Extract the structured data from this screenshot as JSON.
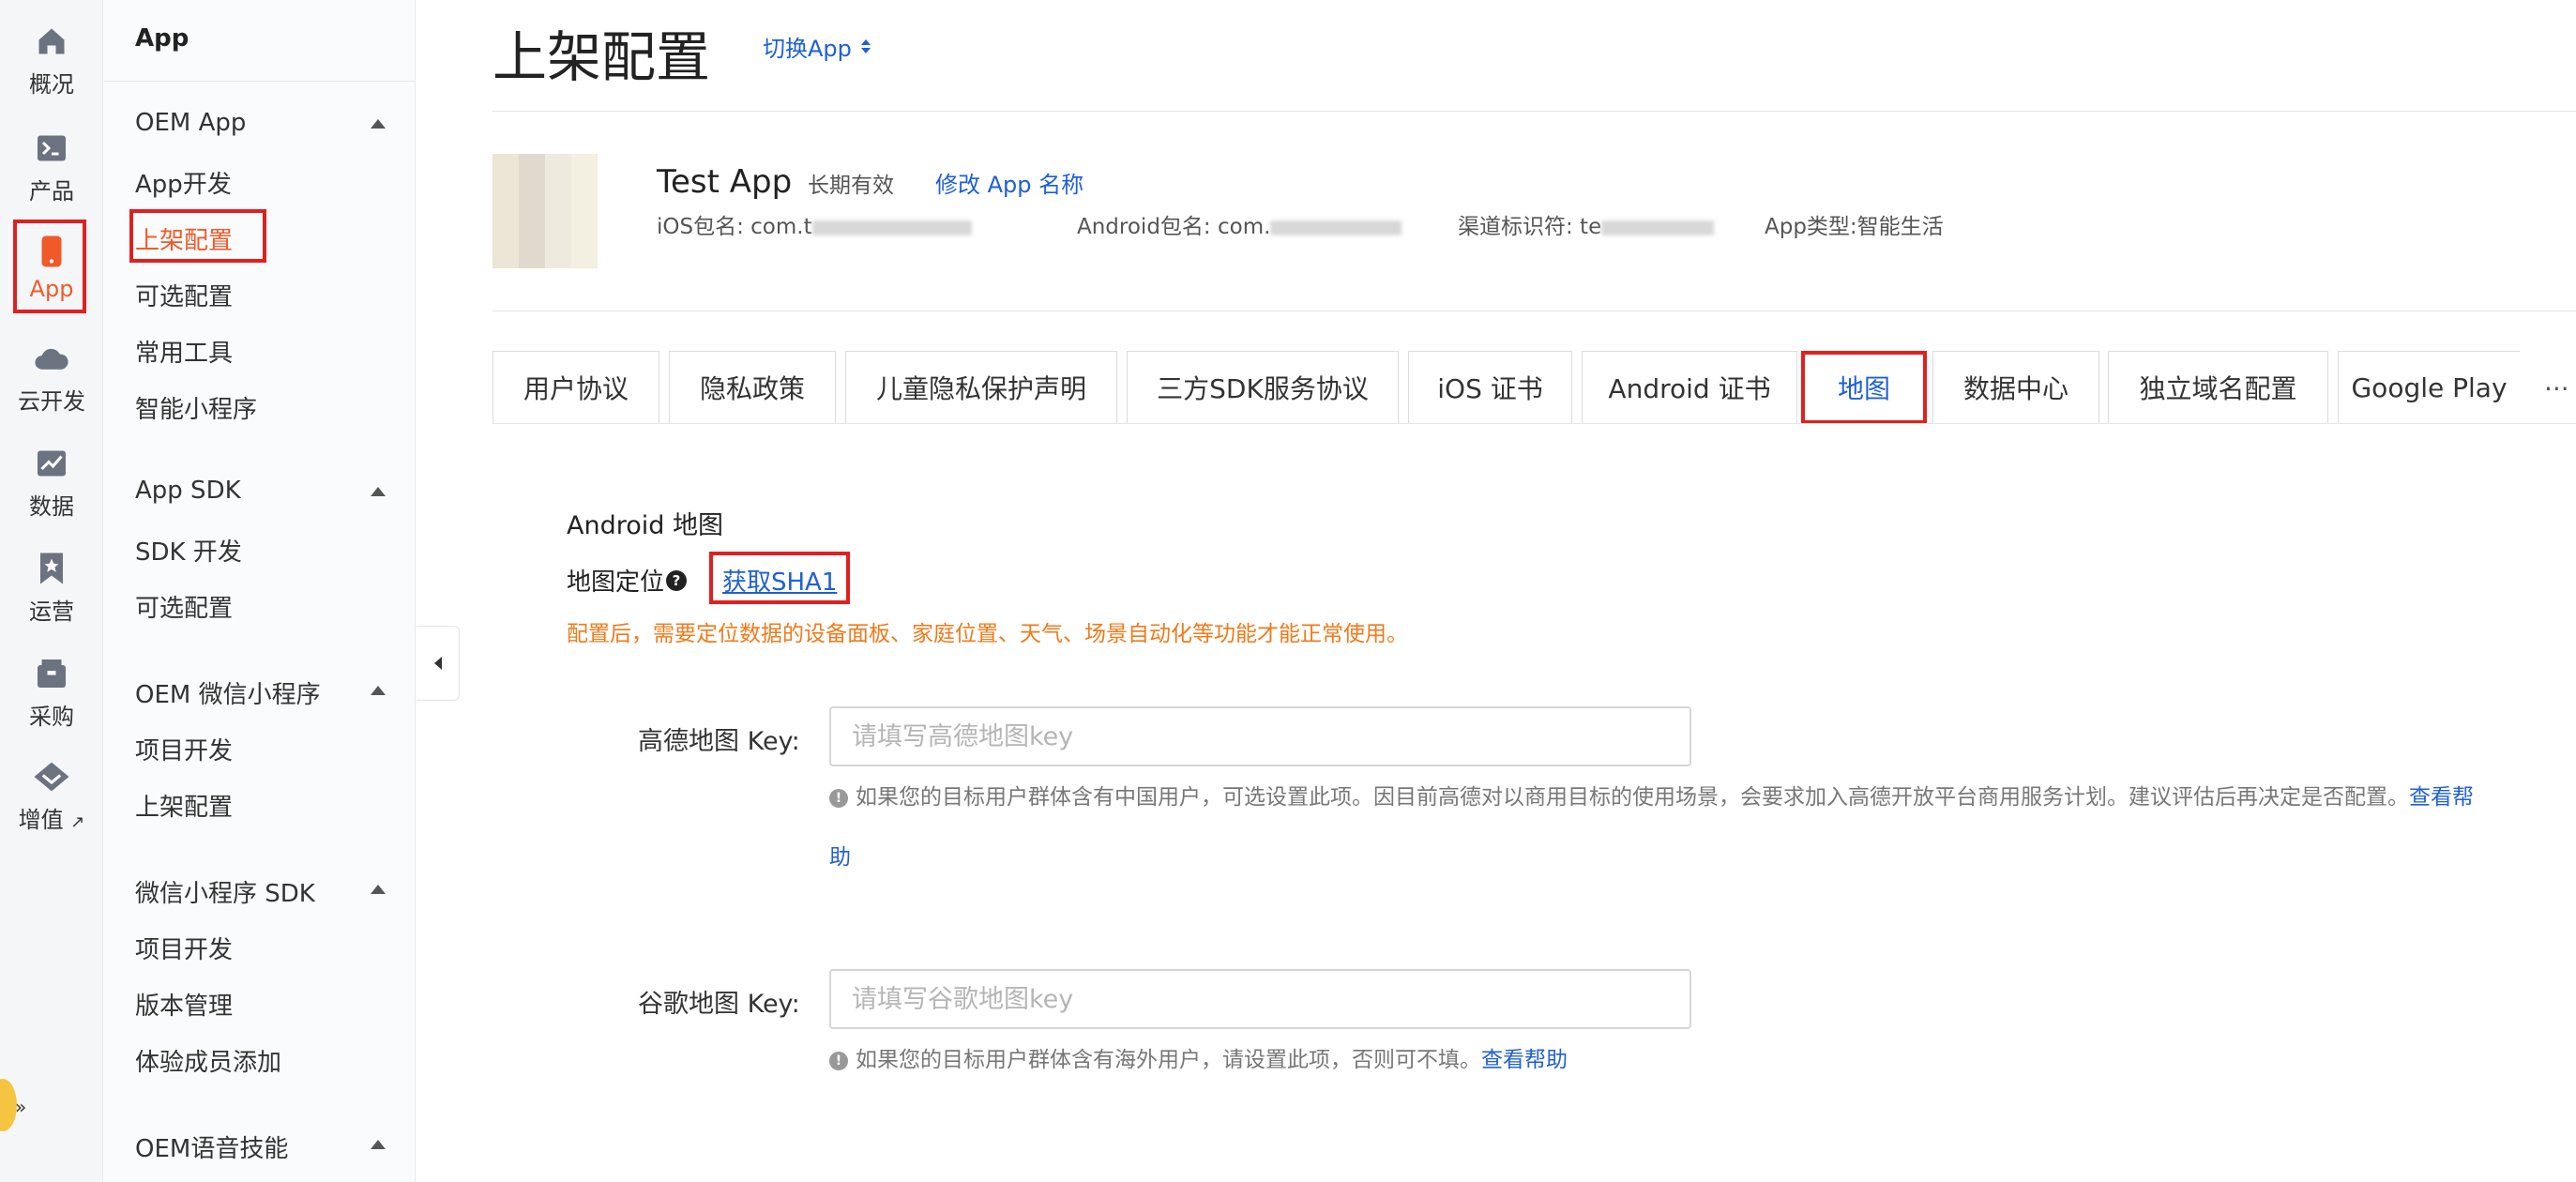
{
  "rail": {
    "items": [
      {
        "label": "概况",
        "icon": "home-icon"
      },
      {
        "label": "产品",
        "icon": "terminal-icon"
      },
      {
        "label": "App",
        "icon": "phone-icon",
        "active": true
      },
      {
        "label": "云开发",
        "icon": "cloud-icon"
      },
      {
        "label": "数据",
        "icon": "chart-icon"
      },
      {
        "label": "运营",
        "icon": "bookmark-star-icon"
      },
      {
        "label": "采购",
        "icon": "box-icon"
      },
      {
        "label": "增值",
        "icon": "diamond-icon"
      }
    ],
    "external_mark": "↗",
    "accent_color": "#f05a2a"
  },
  "menu": {
    "title": "App",
    "groups": [
      {
        "label": "OEM App",
        "items": [
          "App开发",
          "上架配置",
          "可选配置",
          "常用工具",
          "智能小程序"
        ]
      },
      {
        "label": "App SDK",
        "items": [
          "SDK 开发",
          "可选配置"
        ]
      },
      {
        "label": "OEM 微信小程序",
        "items": [
          "项目开发",
          "上架配置"
        ]
      },
      {
        "label": "微信小程序 SDK",
        "items": [
          "项目开发",
          "版本管理",
          "体验成员添加"
        ]
      },
      {
        "label": "OEM语音技能",
        "items": []
      }
    ],
    "active_item": "上架配置"
  },
  "header": {
    "title": "上架配置",
    "switch_label": "切换App"
  },
  "app": {
    "name": "Test App",
    "validity": "长期有效",
    "rename": "修改 App 名称",
    "ios_label": "iOS包名: com.t",
    "android_label": "Android包名: com.",
    "channel_label": "渠道标识符: te",
    "type_label": "App类型:智能生活"
  },
  "tabs": [
    "用户协议",
    "隐私政策",
    "儿童隐私保护声明",
    "三方SDK服务协议",
    "iOS 证书",
    "Android 证书",
    "地图",
    "数据中心",
    "独立域名配置",
    "Google Play"
  ],
  "active_tab": "地图",
  "tabs_more": "···",
  "section": {
    "title": "Android 地图",
    "location_label": "地图定位",
    "help_mark": "?",
    "sha1_link": "获取SHA1",
    "warning": "配置后，需要定位数据的设备面板、家庭位置、天气、场景自动化等功能才能正常使用。"
  },
  "amap": {
    "label": "高德地图 Key:",
    "placeholder": "请填写高德地图key",
    "hint_line1": "如果您的目标用户群体含有中国用户，可选设置此项。因目前高德对以商用目标的使用场景，会要求加入高德开放平台商用服务计划。建议评估后再决定是否配置。",
    "hint_link_part1": "查看帮",
    "hint_link_part2": "助"
  },
  "google": {
    "label": "谷歌地图 Key:",
    "placeholder": "请填写谷歌地图key",
    "hint": "如果您的目标用户群体含有海外用户，请设置此项，否则可不填。",
    "hint_link": "查看帮助"
  },
  "info_mark": "!",
  "colors": {
    "link": "#1f5fd6",
    "warning": "#f07a1a",
    "highlight_box": "#e02020"
  }
}
